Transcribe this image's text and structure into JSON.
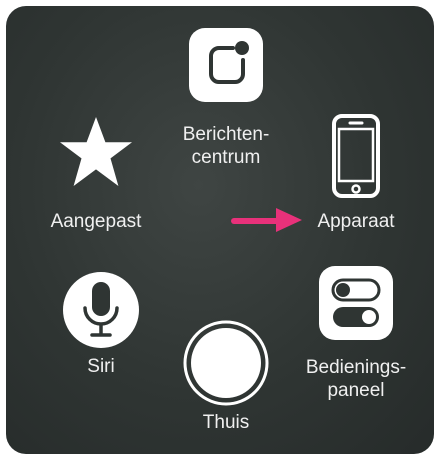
{
  "assistive_touch_menu": {
    "items": [
      {
        "id": "notification-center",
        "label": "Berichten-\ncentrum",
        "icon": "notification-center-icon"
      },
      {
        "id": "custom",
        "label": "Aangepast",
        "icon": "star-icon"
      },
      {
        "id": "device",
        "label": "Apparaat",
        "icon": "iphone-device-icon"
      },
      {
        "id": "siri",
        "label": "Siri",
        "icon": "microphone-icon"
      },
      {
        "id": "home",
        "label": "Thuis",
        "icon": "home-button-icon"
      },
      {
        "id": "control-center",
        "label": "Bedienings-\npaneel",
        "icon": "toggle-switches-icon"
      }
    ],
    "annotation": {
      "icon": "arrow-right-icon",
      "color": "#e8317a",
      "points_to": "device"
    }
  },
  "colors": {
    "panel_background": "#2f3533",
    "icon_white": "#ffffff",
    "label_text": "#f0f0f0",
    "arrow_pink": "#e8317a"
  }
}
